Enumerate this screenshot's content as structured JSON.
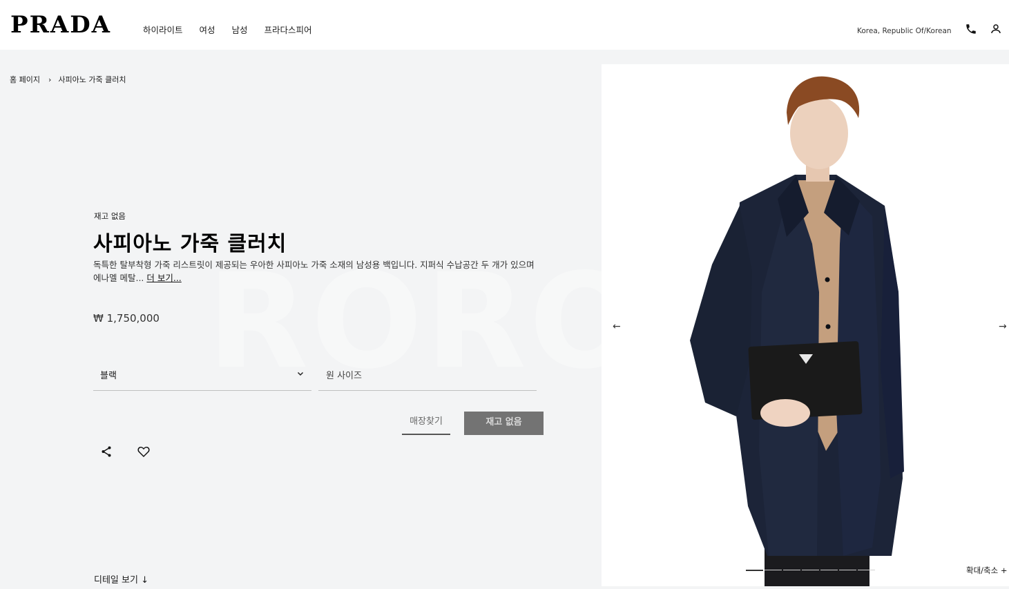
{
  "header": {
    "logo": "PRADA",
    "nav": [
      "하이라이트",
      "여성",
      "남성",
      "프라다스피어"
    ],
    "locale": "Korea, Republic Of/Korean",
    "icons": [
      "phone-icon",
      "user-icon"
    ]
  },
  "breadcrumb": {
    "home": "홈 페이지",
    "separator": "›",
    "current": "사피아노 가죽 클러치"
  },
  "watermark": "RORO",
  "product": {
    "stock_status": "재고 없음",
    "title": "사피아노 가죽 클러치",
    "description": "독특한 탈부착형 가죽 리스트릿이 제공되는 우아한 사피아노 가죽 소재의 남성용 백입니다. 지퍼식 수납공간 두 개가 있으며 에나멜 메탈...",
    "more_label": "더 보기...",
    "price": "₩ 1,750,000",
    "color_select": "블랙",
    "size_select": "원 사이즈",
    "store_button": "매장찾기",
    "soldout_button": "재고 없음",
    "detail_link": "디테일 보기 ↓"
  },
  "gallery": {
    "prev": "←",
    "next": "→",
    "zoom_label": "확대/축소 +",
    "slides": 7,
    "active_slide": 1
  },
  "colors": {
    "background": "#f3f4f5",
    "header_bg": "#ffffff",
    "soldout_bg": "#737373",
    "coat": "#1c2438",
    "shirt": "#c49f7e"
  }
}
